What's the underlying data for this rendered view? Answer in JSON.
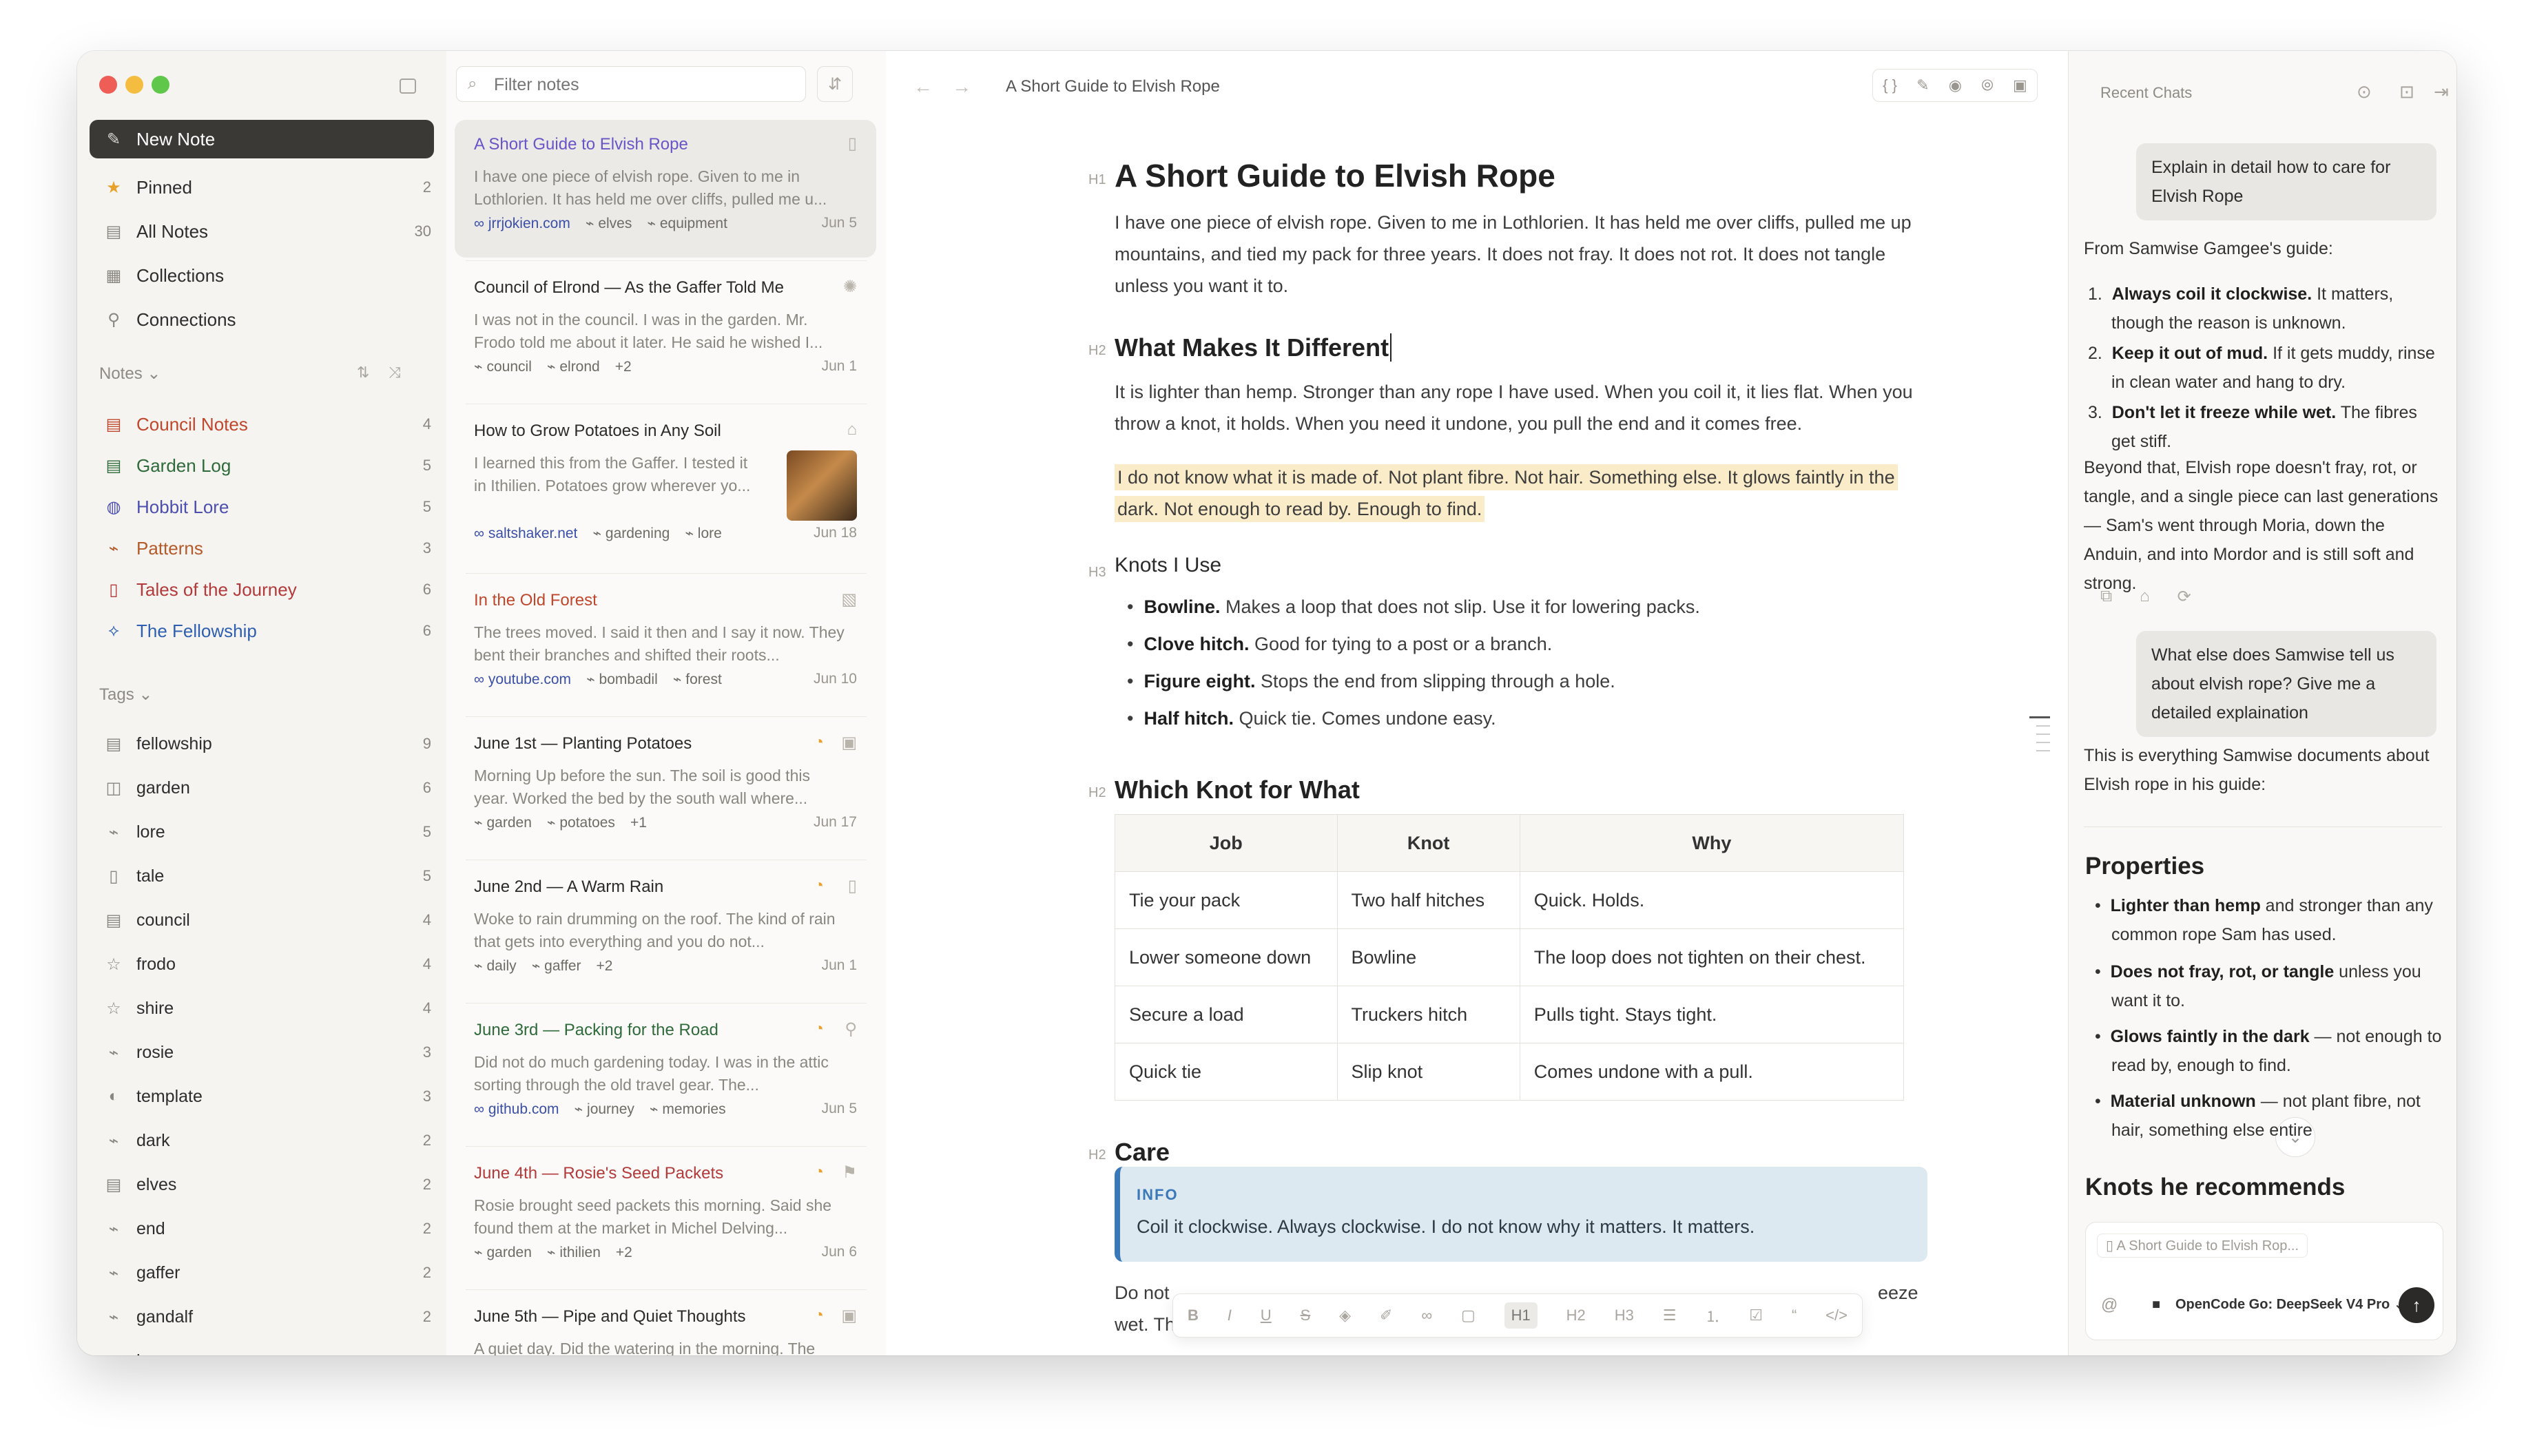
{
  "sidebar": {
    "new_note": "New Note",
    "pinned": {
      "label": "Pinned",
      "count": "2"
    },
    "all_notes": {
      "label": "All Notes",
      "count": "30"
    },
    "collections": "Collections",
    "connections": "Connections",
    "notes_header": "Notes",
    "collections_list": [
      {
        "label": "Council Notes",
        "count": "4",
        "color": "#c0472c"
      },
      {
        "label": "Garden Log",
        "count": "5",
        "color": "#2f6b3a"
      },
      {
        "label": "Hobbit Lore",
        "count": "5",
        "color": "#4c4fb0"
      },
      {
        "label": "Patterns",
        "count": "3",
        "color": "#b55a2a"
      },
      {
        "label": "Tales of the Journey",
        "count": "6",
        "color": "#b33a3a"
      },
      {
        "label": "The Fellowship",
        "count": "6",
        "color": "#2f5fb0"
      }
    ],
    "tags_header": "Tags",
    "tags": [
      {
        "label": "fellowship",
        "count": "9"
      },
      {
        "label": "garden",
        "count": "6"
      },
      {
        "label": "lore",
        "count": "5"
      },
      {
        "label": "tale",
        "count": "5"
      },
      {
        "label": "council",
        "count": "4"
      },
      {
        "label": "frodo",
        "count": "4"
      },
      {
        "label": "shire",
        "count": "4"
      },
      {
        "label": "rosie",
        "count": "3"
      },
      {
        "label": "template",
        "count": "3"
      },
      {
        "label": "dark",
        "count": "2"
      },
      {
        "label": "elves",
        "count": "2"
      },
      {
        "label": "end",
        "count": "2"
      },
      {
        "label": "gaffer",
        "count": "2"
      },
      {
        "label": "gandalf",
        "count": "2"
      },
      {
        "label": "home",
        "count": ""
      }
    ]
  },
  "notelist": {
    "filter_placeholder": "Filter notes",
    "cards": [
      {
        "title": "A Short Guide to Elvish Rope",
        "excerpt": "I have one piece of elvish rope. Given to me in Lothlorien. It has held me over cliffs, pulled me u...",
        "source": "jrrjokien.com",
        "tag1": "elves",
        "tag2": "equipment",
        "date": "Jun 5"
      },
      {
        "title": "Council of Elrond — As the Gaffer Told Me",
        "excerpt": "I was not in the council. I was in the garden. Mr. Frodo told me about it later. He said he wished I...",
        "source": "",
        "tag1": "council",
        "tag2": "elrond",
        "extra": "+2",
        "date": "Jun 1"
      },
      {
        "title": "How to Grow Potatoes in Any Soil",
        "excerpt": "I learned this from the Gaffer. I tested it in Ithilien. Potatoes grow wherever yo...",
        "source": "saltshaker.net",
        "tag1": "gardening",
        "tag2": "lore",
        "date": "Jun 18"
      },
      {
        "title": "In the Old Forest",
        "excerpt": "The trees moved. I said it then and I say it now. They bent their branches and shifted their roots...",
        "source": "youtube.com",
        "tag1": "bombadil",
        "tag2": "forest",
        "date": "Jun 10"
      },
      {
        "title": "June 1st — Planting Potatoes",
        "excerpt": "Morning Up before the sun. The soil is good this year. Worked the bed by the south wall where...",
        "source": "",
        "tag1": "garden",
        "tag2": "potatoes",
        "extra": "+1",
        "date": "Jun 17"
      },
      {
        "title": "June 2nd — A Warm Rain",
        "excerpt": "Woke to rain drumming on the roof. The kind of rain that gets into everything and you do not...",
        "source": "",
        "tag1": "daily",
        "tag2": "gaffer",
        "extra": "+2",
        "date": "Jun 1"
      },
      {
        "title": "June 3rd — Packing for the Road",
        "excerpt": "Did not do much gardening today. I was in the attic sorting through the old travel gear. The...",
        "source": "github.com",
        "tag1": "journey",
        "tag2": "memories",
        "date": "Jun 5"
      },
      {
        "title": "June 4th — Rosie's Seed Packets",
        "excerpt": "Rosie brought seed packets this morning. Said she found them at the market in Michel Delving...",
        "source": "",
        "tag1": "garden",
        "tag2": "ithilien",
        "extra": "+2",
        "date": "Jun 6"
      },
      {
        "title": "June 5th — Pipe and Quiet Thoughts",
        "excerpt": "A quiet day. Did the watering in the morning. The",
        "source": "",
        "tag1": "",
        "tag2": "",
        "date": ""
      }
    ]
  },
  "editor": {
    "breadcrumb": "A Short Guide to Elvish Rope",
    "h1": "A Short Guide to Elvish Rope",
    "p1": "I have one piece of elvish rope. Given to me in Lothlorien. It has held me over cliffs, pulled me up mountains, and tied my pack for three years. It does not fray. It does not rot. It does not tangle unless you want it to.",
    "h2a": "What Makes It Different",
    "p2": "It is lighter than hemp. Stronger than any rope I have used. When you coil it, it lies flat. When you throw a knot, it holds. When you need it undone, you pull the end and it comes free.",
    "p3": "I do not know what it is made of. Not plant fibre. Not hair. Something else. It glows faintly in the dark. Not enough to read by. Enough to find.",
    "h3": "Knots I Use",
    "bullets": [
      {
        "b": "Bowline.",
        "t": " Makes a loop that does not slip. Use it for lowering packs."
      },
      {
        "b": "Clove hitch.",
        "t": " Good for tying to a post or a branch."
      },
      {
        "b": "Figure eight.",
        "t": " Stops the end from slipping through a hole."
      },
      {
        "b": "Half hitch.",
        "t": " Quick tie. Comes undone easy."
      }
    ],
    "h2b": "Which Knot for What",
    "table": {
      "headers": [
        "Job",
        "Knot",
        "Why"
      ],
      "rows": [
        [
          "Tie your pack",
          "Two half hitches",
          "Quick. Holds."
        ],
        [
          "Lower someone down",
          "Bowline",
          "The loop does not tighten on their chest."
        ],
        [
          "Secure a load",
          "Truckers hitch",
          "Pulls tight. Stays tight."
        ],
        [
          "Quick tie",
          "Slip knot",
          "Comes undone with a pull."
        ]
      ]
    },
    "h2c": "Care",
    "info_label": "INFO",
    "info_text": "Coil it clockwise. Always clockwise. I do not know why it matters. It matters.",
    "p4a": "Do not",
    "p4b": "eeze",
    "p4c": "wet. Th",
    "heading_tags": {
      "h1": "H1",
      "h2": "H2",
      "h3": "H3"
    }
  },
  "chat": {
    "title": "Recent Chats",
    "user1": "Explain in detail how to care for Elvish Rope",
    "a1_intro": "From Samwise Gamgee's guide:",
    "a1_list": [
      {
        "b": "Always coil it clockwise.",
        "t": " It matters, though the reason is unknown."
      },
      {
        "b": "Keep it out of mud.",
        "t": " If it gets muddy, rinse in clean water and hang to dry."
      },
      {
        "b": "Don't let it freeze while wet.",
        "t": " The fibres get stiff."
      }
    ],
    "a1_outro": "Beyond that, Elvish rope doesn't fray, rot, or tangle, and a single piece can last generations — Sam's went through Moria, down the Anduin, and into Mordor and is still soft and strong.",
    "user2": "What else does Samwise tell us about elvish rope? Give me a detailed explaination",
    "a2_intro": "This is everything Samwise documents about Elvish rope in his guide:",
    "a2_h": "Properties",
    "a2_list": [
      {
        "b": "Lighter than hemp",
        "t": " and stronger than any common rope Sam has used."
      },
      {
        "b": "Does not fray, rot, or tangle",
        "t": " unless you want it to."
      },
      {
        "b": "Glows faintly in the dark",
        "t": " — not enough to read by, enough to find."
      },
      {
        "b": "Material unknown",
        "t": " — not plant fibre, not hair, something else entire"
      }
    ],
    "a2_h2": "Knots he recommends",
    "context_chip": "A Short Guide to Elvish Rop...",
    "model": "OpenCode Go: DeepSeek V4 Pro"
  }
}
